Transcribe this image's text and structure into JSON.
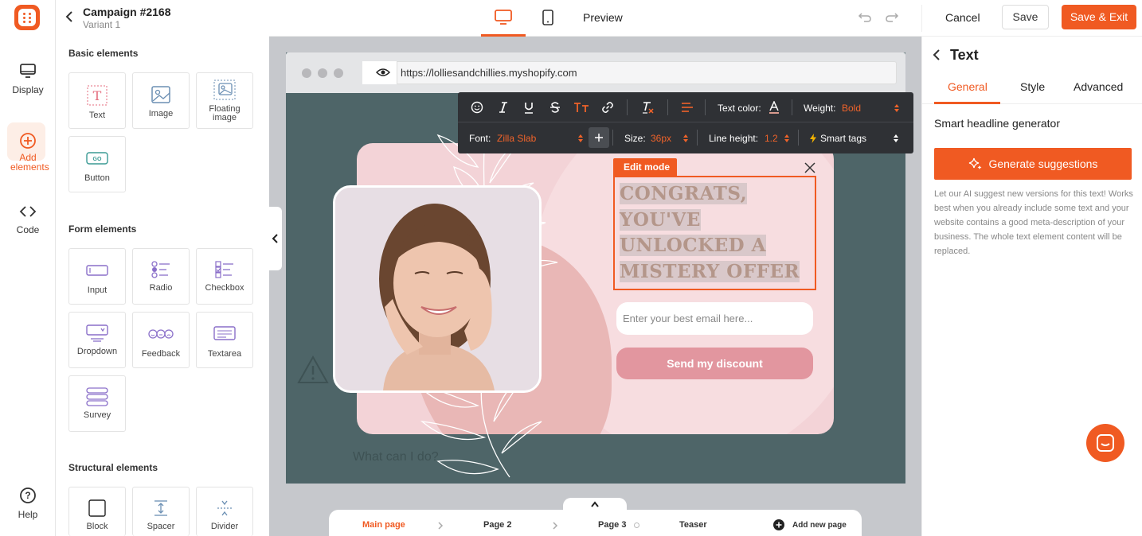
{
  "rail": {
    "items": [
      {
        "label": "Display",
        "icon": "monitor-icon"
      },
      {
        "label": "Add elements",
        "icon": "plus-circle-icon"
      },
      {
        "label": "Code",
        "icon": "code-icon"
      },
      {
        "label": "Help",
        "icon": "help-icon"
      }
    ]
  },
  "campaign": {
    "title": "Campaign #2168",
    "variant": "Variant 1"
  },
  "panel": {
    "basic_title": "Basic elements",
    "basic": [
      "Text",
      "Image",
      "Floating image",
      "Button"
    ],
    "form_title": "Form elements",
    "form": [
      "Input",
      "Radio",
      "Checkbox",
      "Dropdown",
      "Feedback",
      "Textarea",
      "Survey"
    ],
    "structural_title": "Structural elements",
    "structural": [
      "Block",
      "Spacer",
      "Divider"
    ],
    "button_tile_text": "GO"
  },
  "topbar": {
    "preview": "Preview",
    "cancel": "Cancel",
    "save": "Save",
    "save_exit": "Save & Exit"
  },
  "browser": {
    "url": "https://lolliesandchillies.myshopify.com"
  },
  "toolbar": {
    "text_color_label": "Text color:",
    "weight_label": "Weight:",
    "weight_value": "Bold",
    "font_label": "Font:",
    "font_value": "Zilla Slab",
    "size_label": "Size:",
    "size_value": "36px",
    "line_height_label": "Line height:",
    "line_height_value": "1.2",
    "smart_tags": "Smart tags"
  },
  "popup": {
    "edit_mode": "Edit mode",
    "headline_lines": [
      "CONGRATS,",
      "YOU'VE",
      "UNLOCKED A",
      "MISTERY OFFER"
    ],
    "email_placeholder": "Enter your best email here...",
    "send_button": "Send my discount"
  },
  "background_text": "What can I do?",
  "pages": {
    "items": [
      "Main page",
      "Page 2",
      "Page 3",
      "Teaser"
    ],
    "add": "Add new page"
  },
  "right": {
    "title": "Text",
    "tabs": [
      "General",
      "Style",
      "Advanced"
    ],
    "subtitle": "Smart headline generator",
    "generate": "Generate suggestions",
    "description": "Let our AI suggest new versions for this text! Works best when you already include some text and your website contains a good meta-description of your business. The whole text element content will be replaced."
  },
  "colors": {
    "accent": "#f05a22",
    "toolbar_bg": "#2f3135",
    "popup_bg": "#f3d3d7"
  }
}
